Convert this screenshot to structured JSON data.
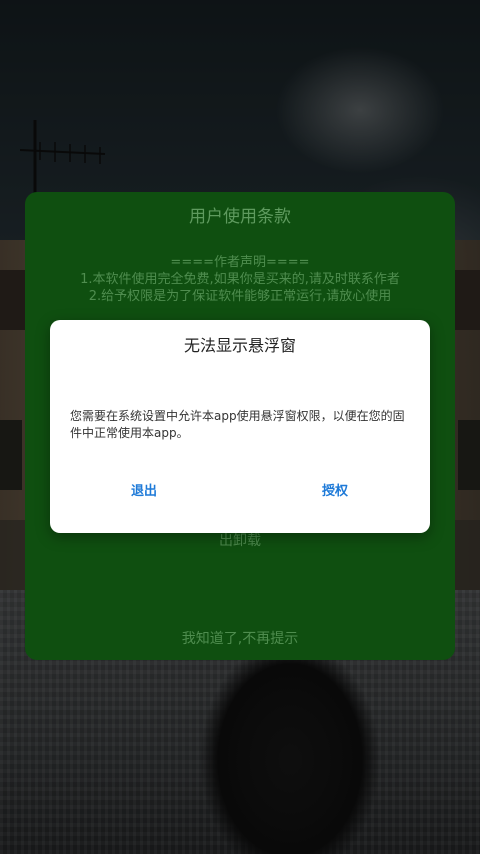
{
  "terms": {
    "title": "用户使用条款",
    "lines": [
      "====作者声明====",
      "1.本软件使用完全免费,如果你是买来的,请及时联系作者",
      "2.给予权限是为了保证软件能够正常运行,请放心使用"
    ],
    "hidden_text": "出卸载",
    "ok_label": "我知道了,不再提示"
  },
  "dialog": {
    "title": "无法显示悬浮窗",
    "message": "您需要在系统设置中允许本app使用悬浮窗权限，以便在您的固件中正常使用本app。",
    "exit_label": "退出",
    "authorize_label": "授权",
    "accent_color": "#1e7ad8"
  },
  "theme": {
    "terms_bg": "#0f4f10",
    "dialog_bg": "#ffffff"
  }
}
